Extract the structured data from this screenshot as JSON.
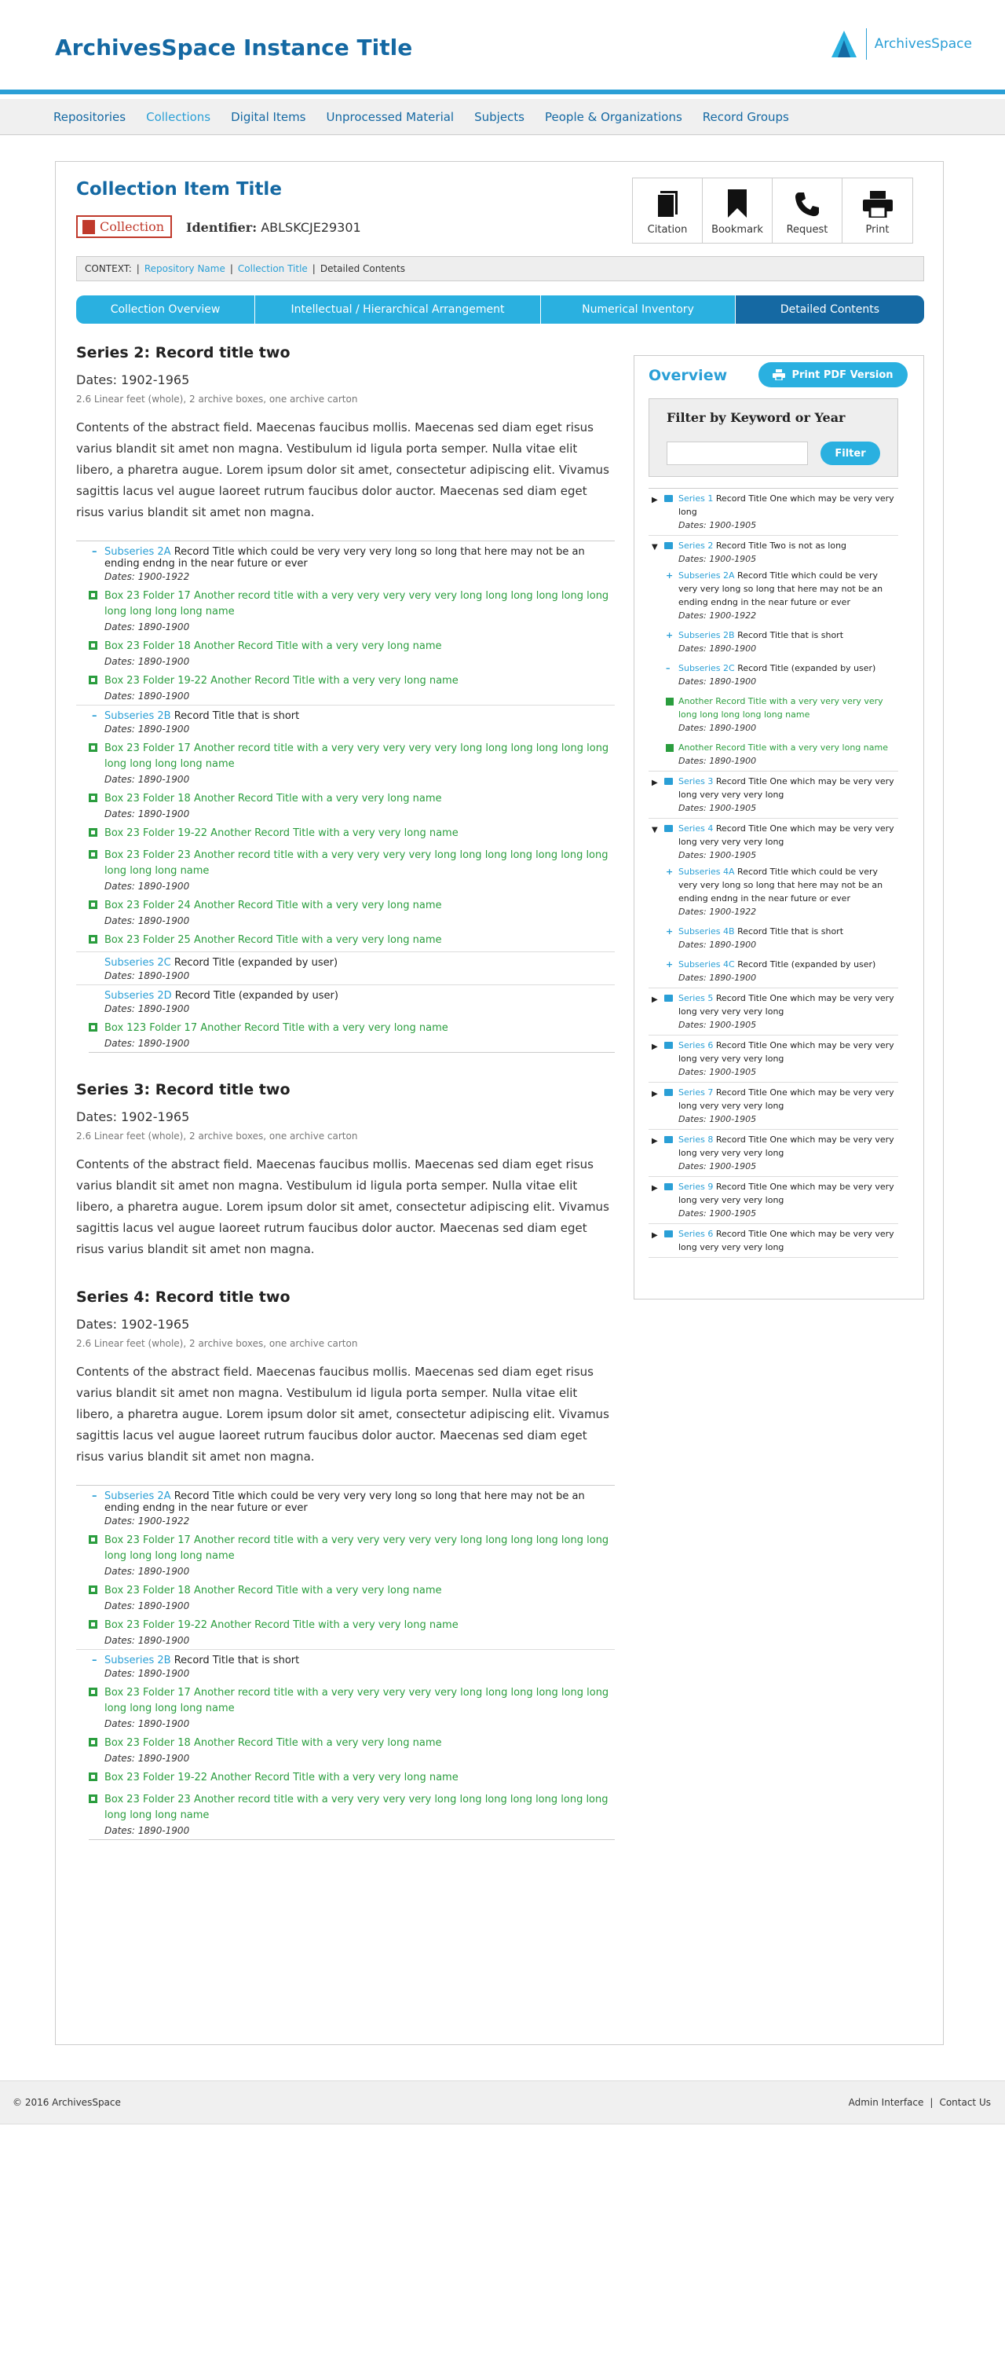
{
  "header": {
    "title": "ArchivesSpace Instance Title",
    "logo_text": "ArchivesSpace"
  },
  "nav": [
    {
      "label": "Repositories"
    },
    {
      "label": "Collections"
    },
    {
      "label": "Digital Items"
    },
    {
      "label": "Unprocessed Material"
    },
    {
      "label": "Subjects"
    },
    {
      "label": "People & Organizations"
    },
    {
      "label": "Record Groups"
    }
  ],
  "record": {
    "title": "Collection Item Title",
    "badge": "Collection",
    "identifier_label": "Identifier:",
    "identifier": "ABLSKCJE29301"
  },
  "tools": [
    {
      "label": "Citation",
      "icon": "book-icon"
    },
    {
      "label": "Bookmark",
      "icon": "bookmark-icon"
    },
    {
      "label": "Request",
      "icon": "phone-icon"
    },
    {
      "label": "Print",
      "icon": "printer-icon"
    }
  ],
  "context": {
    "label": "CONTEXT:",
    "repo": "Repository Name",
    "coll": "Collection Title",
    "current": "Detailed Contents"
  },
  "tabs": [
    {
      "label": "Collection Overview"
    },
    {
      "label": "Intellectual / Hierarchical Arrangement"
    },
    {
      "label": "Numerical Inventory"
    },
    {
      "label": "Detailed Contents"
    }
  ],
  "series": [
    {
      "title": "Series 2: Record title two",
      "dates": "Dates: 1902-1965",
      "extent": "2.6 Linear feet (whole), 2 archive boxes, one archive carton",
      "abstract": "Contents of the abstract field. Maecenas faucibus mollis. Maecenas sed diam eget risus varius blandit sit amet non magna. Vestibulum id ligula porta semper. Nulla vitae elit libero, a pharetra augue. Lorem ipsum dolor sit amet, consectetur adipiscing elit. Vivamus sagittis lacus vel augue laoreet rutrum faucibus dolor auctor. Maecenas sed diam eget risus varius blandit sit amet non magna."
    },
    {
      "title": "Series 3: Record title two",
      "dates": "Dates: 1902-1965",
      "extent": "2.6 Linear feet (whole), 2 archive boxes, one archive carton",
      "abstract": "Contents of the abstract field. Maecenas faucibus mollis. Maecenas sed diam eget risus varius blandit sit amet non magna. Vestibulum id ligula porta semper. Nulla vitae elit libero, a pharetra augue. Lorem ipsum dolor sit amet, consectetur adipiscing elit. Vivamus sagittis lacus vel augue laoreet rutrum faucibus dolor auctor. Maecenas sed diam eget risus varius blandit sit amet non magna."
    },
    {
      "title": "Series 4: Record title two",
      "dates": "Dates: 1902-1965",
      "extent": "2.6 Linear feet (whole), 2 archive boxes, one archive carton",
      "abstract": "Contents of the abstract field. Maecenas faucibus mollis. Maecenas sed diam eget risus varius blandit sit amet non magna. Vestibulum id ligula porta semper. Nulla vitae elit libero, a pharetra augue. Lorem ipsum dolor sit amet, consectetur adipiscing elit. Vivamus sagittis lacus vel augue laoreet rutrum faucibus dolor auctor. Maecenas sed diam eget risus varius blandit sit amet non magna."
    }
  ],
  "tree_a": {
    "s2a_lbl": "Subseries 2A",
    "s2a_nm": "Record Title which could be very very very long so long that here may not be an ending endng in the near future or ever",
    "s2a_dt": "Dates: 1900-1922",
    "i1": "Box 23 Folder 17 Another record title with a very very very very very long long long long long long long long long long name",
    "i1d": "Dates: 1890-1900",
    "i2": "Box 23 Folder 18 Another Record Title with a very very long name",
    "i2d": "Dates: 1890-1900",
    "i3": "Box 23 Folder 19-22 Another Record Title with a very very long name",
    "i3d": "Dates: 1890-1900",
    "s2b_lbl": "Subseries 2B",
    "s2b_nm": "Record Title that is short",
    "s2b_dt": "Dates: 1890-1900",
    "i4": "Box 23 Folder 17 Another record title with a very very very very very long long long long long long long long long long name",
    "i4d": "Dates: 1890-1900",
    "i5": "Box 23 Folder 18 Another Record Title with a very very long name",
    "i5d": "Dates: 1890-1900",
    "i6": "Box 23 Folder 19-22 Another Record Title with a very very long name",
    "i7": "Box 23 Folder 23 Another record title with a very very very very long long long long long long long long long long name",
    "i7d": "Dates: 1890-1900",
    "i8": "Box 23 Folder 24 Another Record Title with a very very long name",
    "i8d": "Dates: 1890-1900",
    "i9": "Box 23 Folder 25 Another Record Title with a very very long name",
    "s2c_lbl": "Subseries 2C",
    "s2c_nm": "Record Title (expanded by user)",
    "s2c_dt": "Dates: 1890-1900",
    "s2d_lbl": "Subseries 2D",
    "s2d_nm": "Record Title (expanded by user)",
    "s2d_dt": "Dates: 1890-1900",
    "i10": "Box 123 Folder 17 Another Record Title with a very very long name",
    "i10d": "Dates: 1890-1900"
  },
  "tree_b": {
    "s2a_lbl": "Subseries 2A",
    "s2a_nm": "Record Title which could be very very very long so long that here may not be an ending endng in the near future or ever",
    "s2a_dt": "Dates: 1900-1922",
    "i1": "Box 23 Folder 17 Another record title with a very very very very very long long long long long long long long long long name",
    "i1d": "Dates: 1890-1900",
    "i2": "Box 23 Folder 18 Another Record Title with a very very long name",
    "i2d": "Dates: 1890-1900",
    "i3": "Box 23 Folder 19-22 Another Record Title with a very very long name",
    "i3d": "Dates: 1890-1900",
    "s2b_lbl": "Subseries 2B",
    "s2b_nm": "Record Title that is short",
    "s2b_dt": "Dates: 1890-1900",
    "i4": "Box 23 Folder 17 Another record title with a very very very very very long long long long long long long long long long name",
    "i4d": "Dates: 1890-1900",
    "i5": "Box 23 Folder 18 Another Record Title with a very very long name",
    "i5d": "Dates: 1890-1900",
    "i6": "Box 23 Folder 19-22 Another Record Title with a very very long name",
    "i7": "Box 23 Folder 23 Another record title with a very very very very long long long long long long long long long long name",
    "i7d": "Dates: 1890-1900"
  },
  "sidebar": {
    "title": "Overview",
    "pdf": "Print PDF Version",
    "filter_title": "Filter by Keyword or Year",
    "filter_btn": "Filter",
    "s1_lbl": "Series 1",
    "s1_nm": "Record Title One which may be very very long",
    "s1_dt": "Dates: 1900-1905",
    "s2_lbl": "Series 2",
    "s2_nm": "Record Title Two is not as long",
    "s2_dt": "Dates: 1900-1905",
    "s2a_lbl": "Subseries 2A",
    "s2a_nm": "Record Title which could be very very very long so long that here may not be an ending endng in the near future or ever",
    "s2a_dt": "Dates: 1900-1922",
    "s2b_lbl": "Subseries 2B",
    "s2b_nm": "Record Title that is short",
    "s2b_dt": "Dates: 1890-1900",
    "s2c_lbl": "Subseries 2C",
    "s2c_nm": "Record Title (expanded by user)",
    "s2c_dt": "Dates: 1890-1900",
    "s2c_i1": "Another Record Title with a very very very very long long long long long name",
    "s2c_i1d": "Dates: 1890-1900",
    "s2c_i2": "Another Record Title with a very very long name",
    "s2c_i2d": "Dates: 1890-1900",
    "s3_lbl": "Series 3",
    "s3_nm": "Record Title One which may be very very long very very very long",
    "s3_dt": "Dates: 1900-1905",
    "s4_lbl": "Series 4",
    "s4_nm": "Record Title One which may be very very long very very very long",
    "s4_dt": "Dates: 1900-1905",
    "s4a_lbl": "Subseries 4A",
    "s4a_nm": "Record Title which could be very very very long so long that here may not be an ending endng in the near future or ever",
    "s4a_dt": "Dates: 1900-1922",
    "s4b_lbl": "Subseries 4B",
    "s4b_nm": "Record Title that is short",
    "s4b_dt": "Dates: 1890-1900",
    "s4c_lbl": "Subseries 4C",
    "s4c_nm": "Record Title (expanded by user)",
    "s4c_dt": "Dates: 1890-1900",
    "s5_lbl": "Series 5",
    "s5_nm": "Record Title One which may be very very long very very very long",
    "s5_dt": "Dates: 1900-1905",
    "s6_lbl": "Series 6",
    "s6_nm": "Record Title One which may be very very long very very very long",
    "s6_dt": "Dates: 1900-1905",
    "s7_lbl": "Series 7",
    "s7_nm": "Record Title One which may be very very long very very very long",
    "s7_dt": "Dates: 1900-1905",
    "s8_lbl": "Series 8",
    "s8_nm": "Record Title One which may be very very long very very very long",
    "s8_dt": "Dates: 1900-1905",
    "s9_lbl": "Series 9",
    "s9_nm": "Record Title One which may be very very long very very very long",
    "s9_dt": "Dates: 1900-1905",
    "s6b_lbl": "Series 6",
    "s6b_nm": "Record Title One which may be very very long very very very long"
  },
  "footer": {
    "copy": "© 2016 ArchivesSpace",
    "admin": "Admin Interface",
    "sep": "|",
    "contact": "Contact Us"
  }
}
